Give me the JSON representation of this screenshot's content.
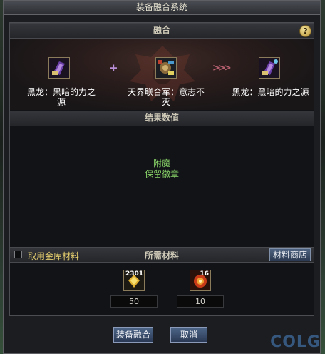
{
  "window": {
    "title": "装备融合系统"
  },
  "fusion": {
    "header": "融合",
    "help_icon": "?",
    "plus_symbol": "+",
    "arrow_symbol": ">>>",
    "source_item": {
      "name": "黑龙：黑暗的力之源",
      "icon": "purple-bracer-icon"
    },
    "material_item": {
      "name": "天界联合军：意志不灭",
      "icon": "gear-badge-icon"
    },
    "result_item": {
      "name": "黑龙：黑暗的力之源",
      "icon": "purple-bracer-icon"
    }
  },
  "result": {
    "header": "结果数值",
    "lines": [
      "附魔",
      "保留徽章"
    ]
  },
  "materials": {
    "header": "所需材料",
    "use_vault_label": "取用金库材料",
    "use_vault_checked": false,
    "shop_button": "材料商店",
    "items": [
      {
        "icon": "gold-gem-icon",
        "badge": "2301",
        "count": "50"
      },
      {
        "icon": "fire-burst-icon",
        "badge": "16",
        "count": "10"
      }
    ]
  },
  "buttons": {
    "confirm": "装备融合",
    "cancel": "取消"
  },
  "watermark": "COLG",
  "colors": {
    "accent_green": "#8ad66a",
    "label_gold": "#e6cf6e",
    "button_blue": "#3c5070"
  }
}
